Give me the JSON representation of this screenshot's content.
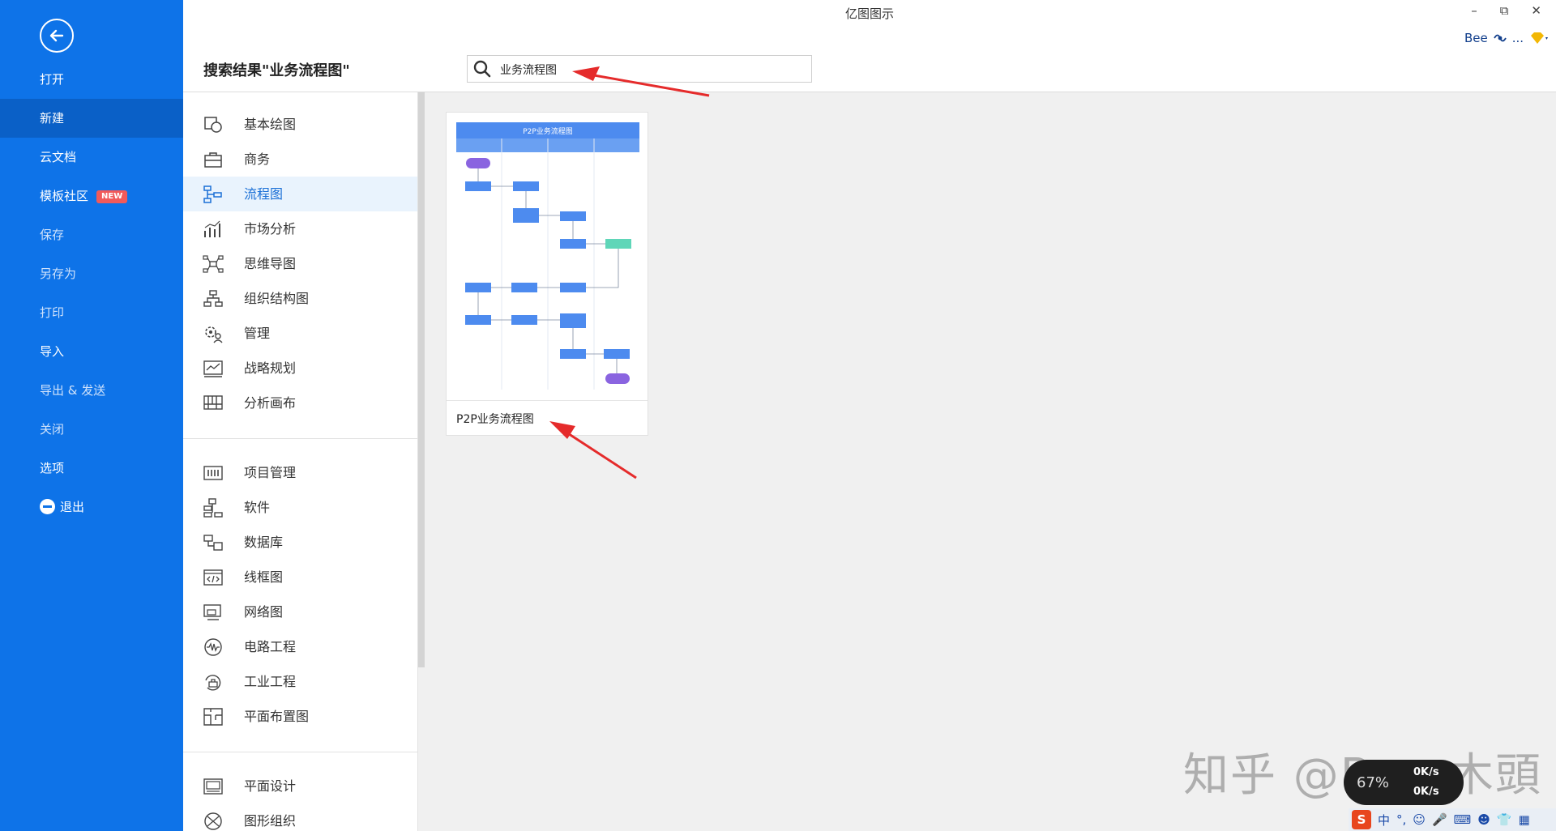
{
  "app": {
    "title": "亿图图示"
  },
  "window": {
    "minimize": "–",
    "restore": "⧉",
    "close": "✕"
  },
  "user": {
    "name": "Bee",
    "more": "..."
  },
  "nav": {
    "open": "打开",
    "new": "新建",
    "cloud": "云文档",
    "community": "模板社区",
    "new_badge": "NEW",
    "save": "保存",
    "save_as": "另存为",
    "print": "打印",
    "import": "导入",
    "export": "导出 & 发送",
    "close": "关闭",
    "options": "选项",
    "exit": "退出"
  },
  "header": {
    "result_title": "搜索结果\"业务流程图\""
  },
  "search": {
    "value": "业务流程图"
  },
  "categories": {
    "group1": [
      "基本绘图",
      "商务",
      "流程图",
      "市场分析",
      "思维导图",
      "组织结构图",
      "管理",
      "战略规划",
      "分析画布"
    ],
    "group2": [
      "项目管理",
      "软件",
      "数据库",
      "线框图",
      "网络图",
      "电路工程",
      "工业工程",
      "平面布置图"
    ],
    "group3": [
      "平面设计",
      "图形组织"
    ]
  },
  "template": {
    "label": "P2P业务流程图",
    "thumb_title": "P2P业务流程图"
  },
  "watermark": "知乎 @Bee 木頭",
  "netwidget": {
    "percent": "67%",
    "up": "0K/s",
    "down": "0K/s"
  },
  "ime": {
    "logo": "S",
    "lang": "中",
    "punct": "°,"
  }
}
